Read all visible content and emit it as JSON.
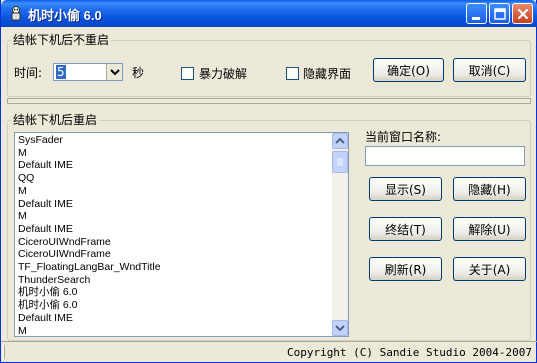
{
  "window": {
    "title": "机时小偷 6.0"
  },
  "group_no_restart": {
    "title": "结帐下机后不重启",
    "time_label": "时间:",
    "time_value": "5",
    "seconds_label": "秒",
    "violent_crack_label": "暴力破解",
    "violent_crack_checked": false,
    "hide_interface_label": "隐藏界面",
    "hide_interface_checked": false,
    "ok_button": "确定(O)",
    "cancel_button": "取消(C)"
  },
  "group_restart": {
    "title": "结帐下机后重启",
    "windows_list": [
      "SysFader",
      "M",
      "Default IME",
      "QQ",
      "M",
      "Default IME",
      "M",
      "Default IME",
      "CiceroUIWndFrame",
      "CiceroUIWndFrame",
      "TF_FloatingLangBar_WndTitle",
      "ThunderSearch",
      "机时小偷 6.0",
      "机时小偷 6.0",
      "Default IME",
      "M"
    ],
    "current_window_label": "当前窗口名称:",
    "current_window_value": "",
    "show_button": "显示(S)",
    "hide_button": "隐藏(H)",
    "end_button": "终结(T)",
    "remove_button": "解除(U)",
    "refresh_button": "刷新(R)",
    "about_button": "关于(A)"
  },
  "status": {
    "copyright": "Copyright (C) Sandie Studio 2004-2007"
  },
  "colors": {
    "titlebar": "#0a52dd",
    "window_bg": "#ece9d8",
    "selection": "#316ac5"
  }
}
